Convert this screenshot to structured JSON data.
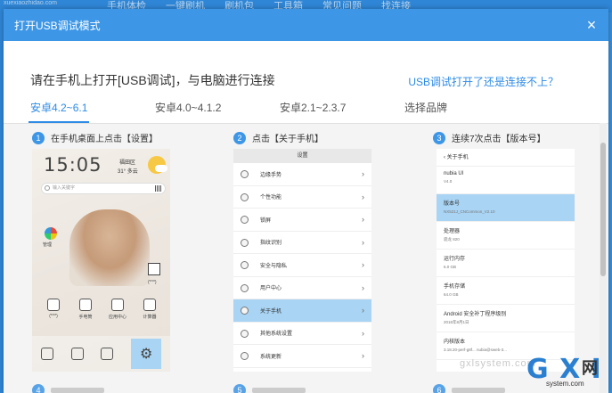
{
  "background": {
    "url": "xuexiaozhidao.com",
    "tabs": [
      "手机体检",
      "一键刷机",
      "刷机包",
      "工具箱",
      "常见问题",
      "找连接"
    ]
  },
  "dialog": {
    "title": "打开USB调试模式",
    "close_icon": "close-icon",
    "instruction": "请在手机上打开[USB调试]，与电脑进行连接",
    "help_link": "USB调试打开了还是连接不上？",
    "tabs": [
      {
        "label": "安卓4.2~6.1",
        "active": true
      },
      {
        "label": "安卓4.0~4.1.2",
        "active": false
      },
      {
        "label": "安卓2.1~2.3.7",
        "active": false
      },
      {
        "label": "选择品牌",
        "active": false
      }
    ]
  },
  "steps": [
    {
      "num": "1",
      "text": "在手机桌面上点击【设置】"
    },
    {
      "num": "2",
      "text": "点击【关于手机】"
    },
    {
      "num": "3",
      "text": "连续7次点击【版本号】"
    }
  ],
  "phone1": {
    "time": "15:05",
    "city": "福田区",
    "temp": "31° 多云",
    "date": "",
    "search_placeholder": "输入关键字",
    "ring_label": "管理",
    "side_label": "(*^*)",
    "grid": [
      "(*^*)",
      "手电筒",
      "应用中心",
      "计算器"
    ]
  },
  "phone2": {
    "header": "设置",
    "rows": [
      {
        "label": "边缘手势",
        "highlight": false
      },
      {
        "label": "个性功能",
        "highlight": false
      },
      {
        "label": "锁屏",
        "highlight": false
      },
      {
        "label": "指纹识别",
        "highlight": false
      },
      {
        "label": "安全与隐私",
        "highlight": false
      },
      {
        "label": "用户中心",
        "highlight": false
      },
      {
        "label": "关于手机",
        "highlight": true
      },
      {
        "label": "其他系统设置",
        "highlight": false
      },
      {
        "label": "系统更新",
        "highlight": false
      }
    ]
  },
  "phone3": {
    "header": "‹ 关于手机",
    "items": [
      {
        "k": "nubia UI",
        "v": "V4.0",
        "highlight": false
      },
      {
        "k": "版本号",
        "v": "NX521J_CNCommon_V2.10",
        "highlight": true
      },
      {
        "k": "处理器",
        "v": "骁龙 820",
        "highlight": false
      },
      {
        "k": "运行内存",
        "v": "6.0 GB",
        "highlight": false
      },
      {
        "k": "手机存储",
        "v": "64.0 GB",
        "highlight": false
      },
      {
        "k": "Android 安全补丁程序级别",
        "v": "2016年8月1日",
        "highlight": false
      },
      {
        "k": "内核版本",
        "v": "3.18.20-perf-g8f...\nnubia@sweb-3...",
        "highlight": false
      }
    ]
  },
  "watermark": {
    "logo": "G X I",
    "net": "网",
    "url": "system.com",
    "faint": "gxlsystem.com"
  }
}
